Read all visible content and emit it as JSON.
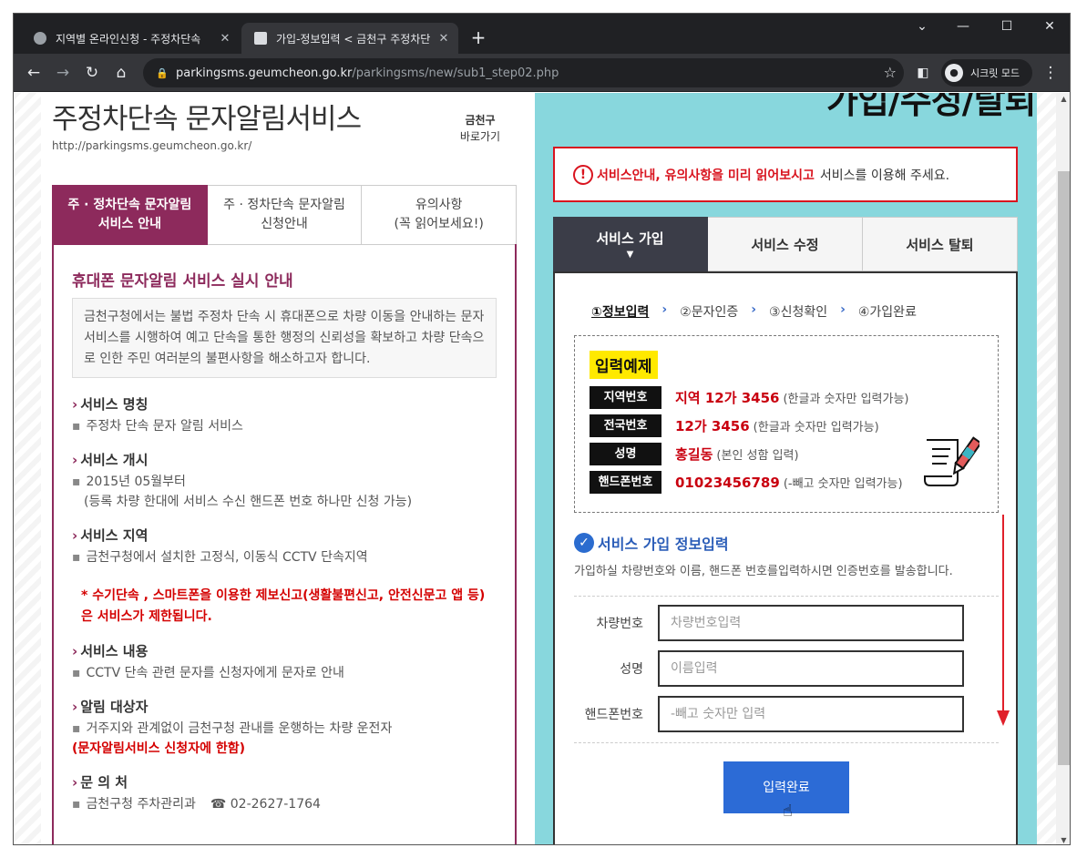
{
  "browser": {
    "tabs": [
      {
        "title": "지역별 온라인신청 - 주정차단속",
        "close": "✕"
      },
      {
        "title": "가입-정보입력 < 금천구 주정차단",
        "close": "✕"
      }
    ],
    "new_tab": "+",
    "window_controls": {
      "minimize": "—",
      "maximize": "☐",
      "close": "✕"
    },
    "url_host": "parkingsms.geumcheon.go.kr",
    "url_path": "/parkingsms/new/sub1_step02.php",
    "incognito_label": "시크릿 모드"
  },
  "left": {
    "title": "주정차단속 문자알림서비스",
    "url": "http://parkingsms.geumcheon.go.kr/",
    "shortcut": {
      "line1": "금천구",
      "line2": "바로가기"
    },
    "tabs": [
      {
        "line1": "주 · 정차단속 문자알림",
        "line2": "서비스 안내"
      },
      {
        "line1": "주 · 정차단속 문자알림",
        "line2": "신청안내"
      },
      {
        "line1": "유의사항",
        "line2": "(꼭 읽어보세요!)"
      }
    ],
    "section_title": "휴대폰 문자알림 서비스 실시 안내",
    "intro": "금천구청에서는 불법 주정차 단속 시 휴대폰으로 차량 이동을 안내하는 문자서비스를 시행하여 예고 단속을 통한 행정의 신뢰성을 확보하고 차량 단속으로 인한 주민 여러분의 불편사항을 해소하고자 합니다.",
    "items": {
      "name_h": "서비스 명칭",
      "name_d": "주정차 단속 문자 알림 서비스",
      "start_h": "서비스 개시",
      "start_d1": "2015년 05월부터",
      "start_d2": "(등록 차량 한대에 서비스 수신 핸드폰 번호 하나만 신청 가능)",
      "area_h": "서비스 지역",
      "area_d": "금천구청에서 설치한 고정식, 이동식 CCTV 단속지역",
      "warn1": "* 수기단속 , 스마트폰을 이용한 제보신고(생활불편신고, 안전신문고 앱 등)",
      "warn2": "은 서비스가 제한됩니다.",
      "content_h": "서비스 내용",
      "content_d": "CCTV 단속 관련 문자를 신청자에게 문자로 안내",
      "target_h": "알림 대상자",
      "target_d1": "거주지와 관계없이 금천구청 관내를 운행하는 차량 운전자",
      "target_d2": "(문자알림서비스 신청자에 한함)",
      "contact_h": "문 의 처",
      "contact_d": "금천구청 주차관리과",
      "contact_phone": "☎ 02-2627-1764"
    }
  },
  "right": {
    "heading": "가입/수정/탈퇴",
    "notice_em": "서비스안내, 유의사항을 미리 읽어보시고",
    "notice_rest": "서비스를 이용해 주세요.",
    "tabs": [
      "서비스 가입",
      "서비스 수정",
      "서비스 탈퇴"
    ],
    "steps": [
      "①정보입력",
      "②문자인증",
      "③신청확인",
      "④가입완료"
    ],
    "example_tag": "입력예제",
    "examples": [
      {
        "label": "지역번호",
        "value": "지역 12가 3456",
        "note": "(한글과 숫자만 입력가능)"
      },
      {
        "label": "전국번호",
        "value": "12가 3456",
        "note": "(한글과 숫자만 입력가능)"
      },
      {
        "label": "성명",
        "value": "홍길동",
        "note": "(본인 성함 입력)"
      },
      {
        "label": "핸드폰번호",
        "value": "01023456789",
        "note": "(-빼고 숫자만 입력가능)"
      }
    ],
    "form_title": "서비스 가입 정보입력",
    "form_desc": "가입하실 차량번호와 이름, 핸드폰 번호를입력하시면 인증번호를 발송합니다.",
    "fields": [
      {
        "label": "차량번호",
        "placeholder": "차량번호입력",
        "value": ""
      },
      {
        "label": "성명",
        "placeholder": "이름입력",
        "value": ""
      },
      {
        "label": "핸드폰번호",
        "placeholder": "-빼고 숫자만 입력",
        "value": ""
      }
    ],
    "submit": "입력완료"
  },
  "colors": {
    "brand": "#8d2a5c",
    "accent_blue": "#2c6bd6",
    "panel_bg": "#88d7dd",
    "alert_red": "#d9141f"
  }
}
